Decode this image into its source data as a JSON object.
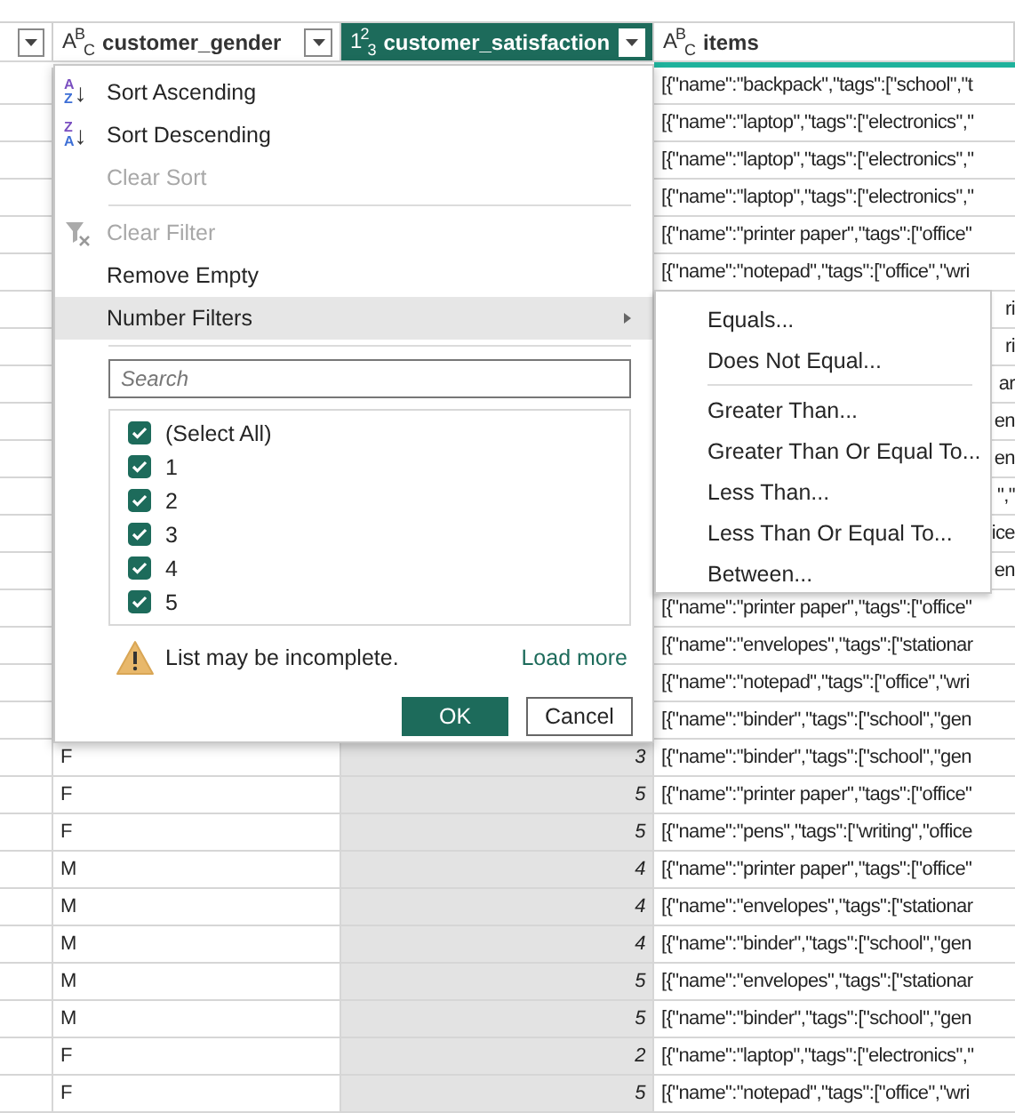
{
  "columns": [
    {
      "filter_button": true,
      "selected": false
    },
    {
      "type_label": "A$^{B}$$_{C}$",
      "label": "customer_gender",
      "filter_button": true,
      "selected": false
    },
    {
      "type_label": "1$^{2}$$_{3}$",
      "label": "customer_satisfaction",
      "filter_button": true,
      "selected": true
    },
    {
      "type_label": "A$^{B}$$_{C}$",
      "label": "items",
      "filter_button": false,
      "selected": false
    }
  ],
  "rows": [
    {
      "items": "[{\"name\":\"backpack\",\"tags\":[\"school\",\"t"
    },
    {
      "items": "[{\"name\":\"laptop\",\"tags\":[\"electronics\",\""
    },
    {
      "items": "[{\"name\":\"laptop\",\"tags\":[\"electronics\",\""
    },
    {
      "items": "[{\"name\":\"laptop\",\"tags\":[\"electronics\",\""
    },
    {
      "items": "[{\"name\":\"printer paper\",\"tags\":[\"office\""
    },
    {
      "items": "[{\"name\":\"notepad\",\"tags\":[\"office\",\"wri"
    },
    {
      "items_fragment": "ri"
    },
    {
      "items_fragment": "ri"
    },
    {
      "items_fragment": "ar"
    },
    {
      "items_fragment": "en"
    },
    {
      "items_fragment": "en"
    },
    {
      "items_fragment": "\",\""
    },
    {
      "items_fragment": "ice"
    },
    {
      "items_fragment": "en"
    },
    {
      "items": "[{\"name\":\"printer paper\",\"tags\":[\"office\""
    },
    {
      "items": "[{\"name\":\"envelopes\",\"tags\":[\"stationar"
    },
    {
      "items": "[{\"name\":\"notepad\",\"tags\":[\"office\",\"wri"
    },
    {
      "items": "[{\"name\":\"binder\",\"tags\":[\"school\",\"gen"
    },
    {
      "gender": "F",
      "satisfaction": "3",
      "items": "[{\"name\":\"binder\",\"tags\":[\"school\",\"gen"
    },
    {
      "gender": "F",
      "satisfaction": "5",
      "items": "[{\"name\":\"printer paper\",\"tags\":[\"office\""
    },
    {
      "gender": "F",
      "satisfaction": "5",
      "items": "[{\"name\":\"pens\",\"tags\":[\"writing\",\"office"
    },
    {
      "gender": "M",
      "satisfaction": "4",
      "items": "[{\"name\":\"printer paper\",\"tags\":[\"office\""
    },
    {
      "gender": "M",
      "satisfaction": "4",
      "items": "[{\"name\":\"envelopes\",\"tags\":[\"stationar"
    },
    {
      "gender": "M",
      "satisfaction": "4",
      "items": "[{\"name\":\"binder\",\"tags\":[\"school\",\"gen"
    },
    {
      "gender": "M",
      "satisfaction": "5",
      "items": "[{\"name\":\"envelopes\",\"tags\":[\"stationar"
    },
    {
      "gender": "M",
      "satisfaction": "5",
      "items": "[{\"name\":\"binder\",\"tags\":[\"school\",\"gen"
    },
    {
      "gender": "F",
      "satisfaction": "2",
      "items": "[{\"name\":\"laptop\",\"tags\":[\"electronics\",\""
    },
    {
      "gender": "F",
      "satisfaction": "5",
      "items": "[{\"name\":\"notepad\",\"tags\":[\"office\",\"wri"
    }
  ],
  "menu": {
    "items": [
      {
        "kind": "sort",
        "label": "Sort Ascending",
        "glyph_top": "A",
        "glyph_bottom": "Z",
        "arrow": "↓",
        "disabled": false,
        "highlighted": false
      },
      {
        "kind": "sort",
        "label": "Sort Descending",
        "glyph_top": "Z",
        "glyph_bottom": "A",
        "arrow": "↓",
        "disabled": false,
        "highlighted": false
      },
      {
        "kind": "plain",
        "label": "Clear Sort",
        "disabled": true,
        "highlighted": false
      },
      {
        "kind": "separator"
      },
      {
        "kind": "clear-filter",
        "label": "Clear Filter",
        "disabled": true,
        "highlighted": false
      },
      {
        "kind": "plain",
        "label": "Remove Empty",
        "disabled": false,
        "highlighted": false
      },
      {
        "kind": "submenu",
        "label": "Number Filters",
        "disabled": false,
        "highlighted": true
      },
      {
        "kind": "separator"
      }
    ],
    "search": {
      "placeholder": "Search"
    },
    "values": [
      {
        "label": "(Select All)",
        "checked": true
      },
      {
        "label": "1",
        "checked": true
      },
      {
        "label": "2",
        "checked": true
      },
      {
        "label": "3",
        "checked": true
      },
      {
        "label": "4",
        "checked": true
      },
      {
        "label": "5",
        "checked": true
      }
    ],
    "warning": "List may be incomplete.",
    "load_more": "Load more",
    "buttons": [
      {
        "label": "OK",
        "kind": "primary"
      },
      {
        "label": "Cancel",
        "kind": "secondary"
      }
    ]
  },
  "submenu": {
    "items": [
      {
        "kind": "item",
        "label": "Equals..."
      },
      {
        "kind": "item",
        "label": "Does Not Equal..."
      },
      {
        "kind": "separator"
      },
      {
        "kind": "item",
        "label": "Greater Than..."
      },
      {
        "kind": "item",
        "label": "Greater Than Or Equal To..."
      },
      {
        "kind": "item",
        "label": "Less Than..."
      },
      {
        "kind": "item",
        "label": "Less Than Or Equal To..."
      },
      {
        "kind": "item",
        "label": "Between..."
      }
    ]
  }
}
